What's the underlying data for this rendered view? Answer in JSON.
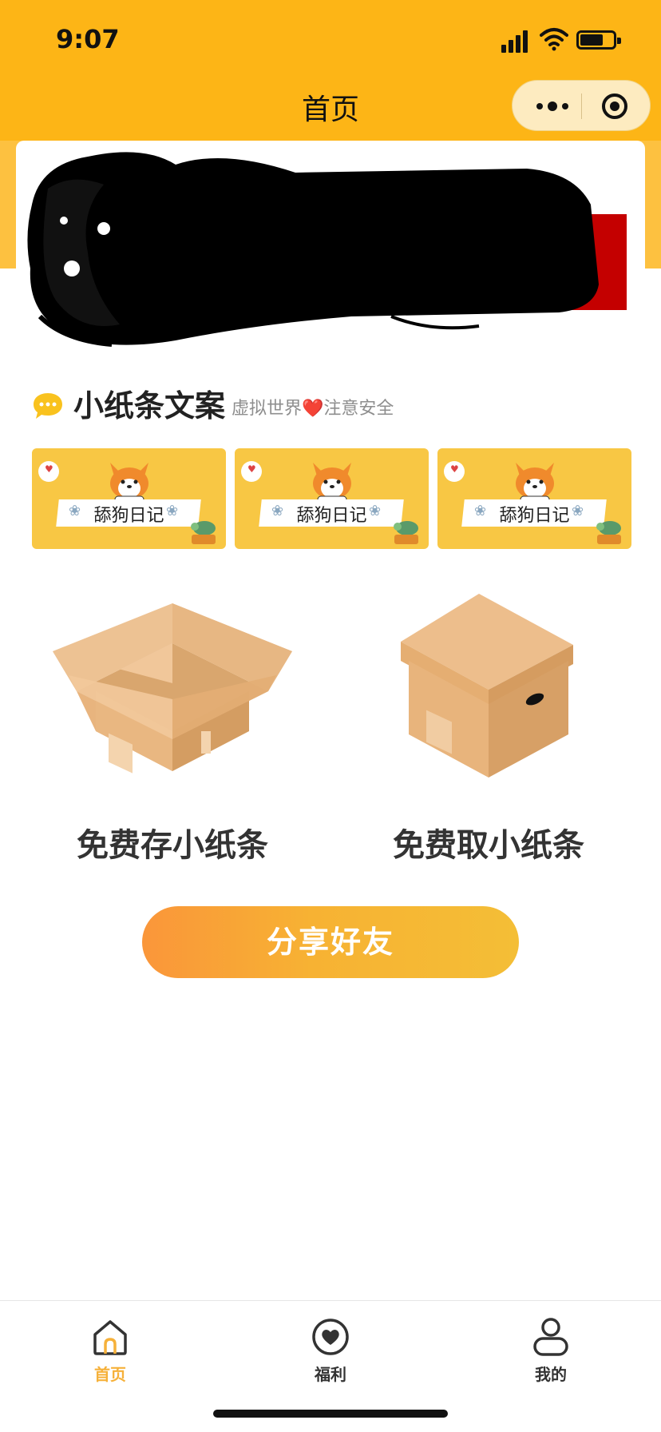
{
  "status_bar": {
    "time": "9:07"
  },
  "nav": {
    "title": "首页"
  },
  "section": {
    "title": "小纸条文案",
    "subtitle": "虚拟世界❤️注意安全"
  },
  "cards": [
    {
      "label": "舔狗日记"
    },
    {
      "label": "舔狗日记"
    },
    {
      "label": "舔狗日记"
    }
  ],
  "actions": {
    "store_label": "免费存小纸条",
    "take_label": "免费取小纸条"
  },
  "share_button": {
    "label": "分享好友"
  },
  "tabbar": [
    {
      "label": "首页",
      "icon": "home-icon",
      "active": true
    },
    {
      "label": "福利",
      "icon": "heart-icon",
      "active": false
    },
    {
      "label": "我的",
      "icon": "user-icon",
      "active": false
    }
  ],
  "colors": {
    "brand_yellow": "#FDB516",
    "card_yellow": "#F8C744",
    "active_tab": "#F6B13A",
    "button_start": "#FA963A",
    "button_end": "#F4BE36"
  }
}
